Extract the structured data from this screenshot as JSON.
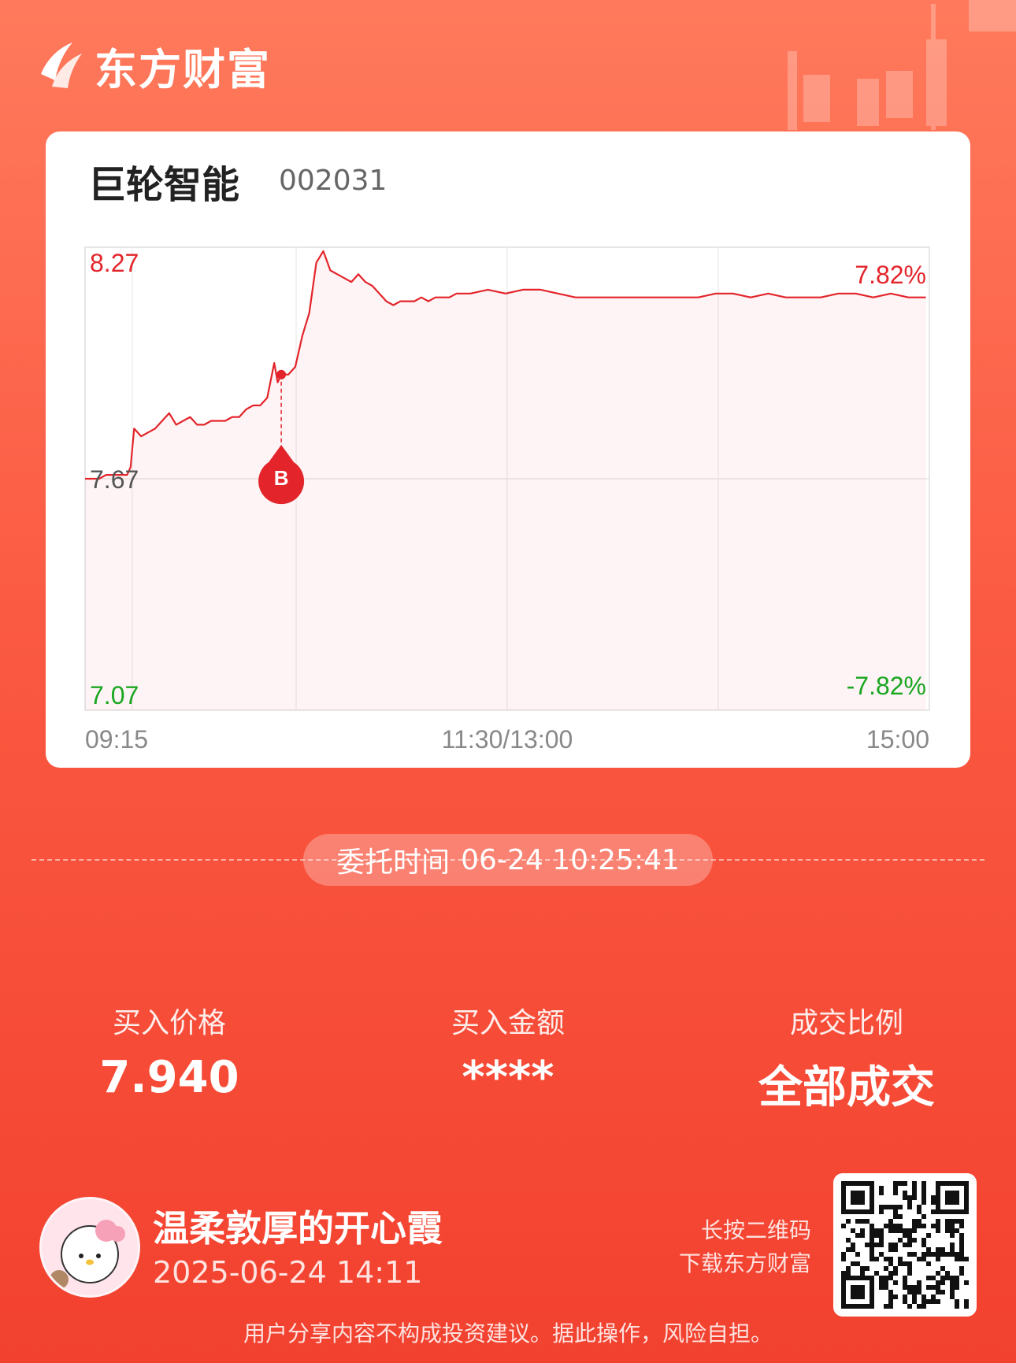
{
  "brand": {
    "name": "东方财富"
  },
  "stock": {
    "name": "巨轮智能",
    "code": "002031"
  },
  "chart_data": {
    "type": "line",
    "x_ticks": [
      "09:15",
      "11:30/13:00",
      "15:00"
    ],
    "y_axis_left": {
      "top": "8.27",
      "mid": "7.67",
      "bottom": "7.07"
    },
    "y_axis_right": {
      "top": "7.82%",
      "bottom": "-7.82%"
    },
    "ylim": [
      7.07,
      8.27
    ],
    "reference_price": 7.67,
    "x_range": [
      0,
      241
    ],
    "buy_marker": {
      "label": "B",
      "x": 56,
      "y": 7.94
    },
    "series": [
      {
        "x": [
          0,
          2,
          4,
          6,
          8,
          10,
          12,
          13,
          14,
          16,
          18,
          20,
          22,
          24,
          26,
          28,
          30,
          32,
          34,
          36,
          38,
          40,
          42,
          44,
          46,
          48,
          50,
          52,
          54,
          55,
          56,
          58,
          60,
          62,
          64,
          66,
          68,
          70,
          72,
          74,
          76,
          78,
          80,
          82,
          84,
          86,
          88,
          90,
          92,
          94,
          96,
          98,
          100,
          102,
          104,
          106,
          108,
          110,
          115,
          120,
          125,
          130,
          135,
          140,
          145,
          150,
          155,
          160,
          165,
          170,
          175,
          180,
          185,
          190,
          195,
          200,
          205,
          210,
          215,
          220,
          225,
          230,
          235,
          240
        ],
        "y": [
          7.67,
          7.67,
          7.67,
          7.68,
          7.68,
          7.68,
          7.68,
          7.7,
          7.8,
          7.78,
          7.79,
          7.8,
          7.82,
          7.84,
          7.81,
          7.82,
          7.83,
          7.81,
          7.81,
          7.82,
          7.82,
          7.82,
          7.83,
          7.83,
          7.85,
          7.86,
          7.86,
          7.88,
          7.97,
          7.92,
          7.94,
          7.94,
          7.96,
          8.04,
          8.1,
          8.23,
          8.26,
          8.21,
          8.2,
          8.19,
          8.18,
          8.2,
          8.18,
          8.17,
          8.15,
          8.13,
          8.12,
          8.13,
          8.13,
          8.13,
          8.14,
          8.13,
          8.14,
          8.14,
          8.14,
          8.15,
          8.15,
          8.15,
          8.16,
          8.15,
          8.16,
          8.16,
          8.15,
          8.14,
          8.14,
          8.14,
          8.14,
          8.14,
          8.14,
          8.14,
          8.14,
          8.15,
          8.15,
          8.14,
          8.15,
          8.14,
          8.14,
          8.14,
          8.15,
          8.15,
          8.14,
          8.15,
          8.14,
          8.14
        ]
      }
    ]
  },
  "order": {
    "time_label": "委托时间",
    "time_value": "06-24 10:25:41"
  },
  "stats": {
    "buy_price_label": "买入价格",
    "buy_price_value": "7.940",
    "buy_amount_label": "买入金额",
    "buy_amount_value": "****",
    "fill_ratio_label": "成交比例",
    "fill_ratio_value": "全部成交"
  },
  "user": {
    "name": "温柔敦厚的开心霞",
    "time": "2025-06-24 14:11"
  },
  "qr": {
    "hint_line1": "长按二维码",
    "hint_line2": "下载东方财富"
  },
  "disclaimer": "用户分享内容不构成投资建议。据此操作，风险自担。",
  "colors": {
    "up": "#e3252b",
    "down": "#1aa620",
    "brand_bg": "#f8543c"
  }
}
